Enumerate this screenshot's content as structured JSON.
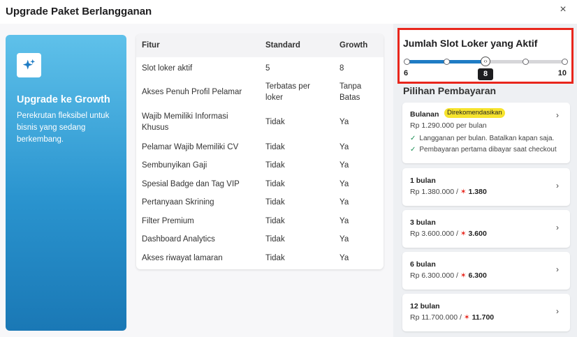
{
  "modal": {
    "title": "Upgrade Paket Berlangganan",
    "close_icon": "×"
  },
  "promo": {
    "title": "Upgrade ke Growth",
    "description": "Perekrutan fleksibel untuk bisnis yang sedang berkembang.",
    "icon": "sparkles-icon"
  },
  "table": {
    "headers": [
      "Fitur",
      "Standard",
      "Growth"
    ],
    "rows": [
      [
        "Slot loker aktif",
        "5",
        "8"
      ],
      [
        "Akses Penuh Profil Pelamar",
        "Terbatas per loker",
        "Tanpa Batas"
      ],
      [
        "Wajib Memiliki Informasi Khusus",
        "Tidak",
        "Ya"
      ],
      [
        "Pelamar Wajib Memiliki CV",
        "Tidak",
        "Ya"
      ],
      [
        "Sembunyikan Gaji",
        "Tidak",
        "Ya"
      ],
      [
        "Spesial Badge dan Tag VIP",
        "Tidak",
        "Ya"
      ],
      [
        "Pertanyaan Skrining",
        "Tidak",
        "Ya"
      ],
      [
        "Filter Premium",
        "Tidak",
        "Ya"
      ],
      [
        "Dashboard Analytics",
        "Tidak",
        "Ya"
      ],
      [
        "Akses riwayat lamaran",
        "Tidak",
        "Ya"
      ]
    ]
  },
  "slots": {
    "title": "Jumlah Slot Loker yang Aktif",
    "min": 6,
    "max": 10,
    "value": 8,
    "min_label": "6",
    "max_label": "10",
    "value_label": "8",
    "accent": "#1f7cc4",
    "highlight_border": "#e8261c"
  },
  "payment": {
    "title": "Pilihan Pembayaran",
    "recommended": {
      "name": "Bulanan",
      "badge": "Direkomendasikan",
      "price": "Rp 1.290.000 per bulan",
      "perks": [
        "Langganan per bulan. Batalkan kapan saja.",
        "Pembayaran pertama dibayar saat checkout"
      ]
    },
    "plans": [
      {
        "name": "1 bulan",
        "price": "Rp 1.380.000 /",
        "promo": "1.380"
      },
      {
        "name": "3 bulan",
        "price": "Rp 3.600.000 /",
        "promo": "3.600"
      },
      {
        "name": "6 bulan",
        "price": "Rp 6.300.000 /",
        "promo": "6.300"
      },
      {
        "name": "12 bulan",
        "price": "Rp 11.700.000 /",
        "promo": "11.700"
      }
    ]
  }
}
